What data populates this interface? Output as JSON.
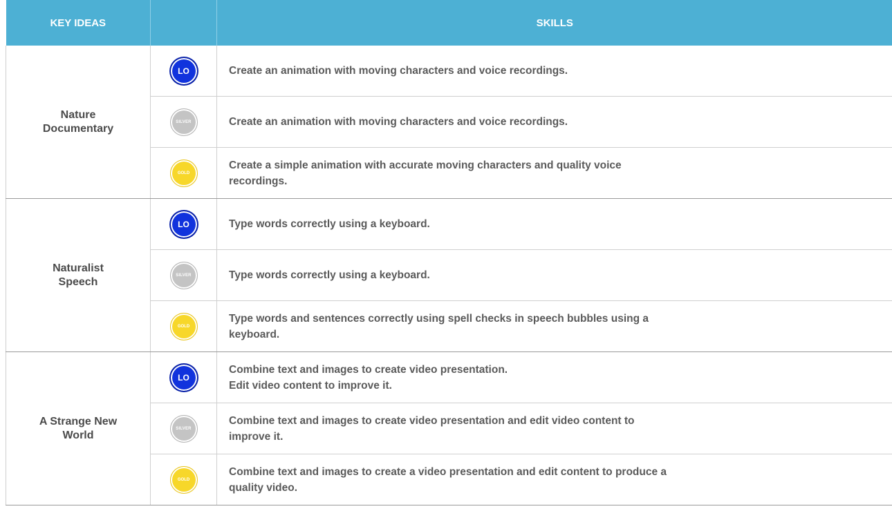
{
  "header": {
    "key_ideas": "KEY IDEAS",
    "skills": "SKILLS"
  },
  "badges": {
    "lo": "LO",
    "silver": "SILVER",
    "gold": "GOLD"
  },
  "colors": {
    "header_bg": "#4db0d4",
    "lo": "#1133dd",
    "silver": "#c4c4c4",
    "gold": "#f7d72a"
  },
  "groups": [
    {
      "key_idea_lines": [
        "Nature",
        "Documentary"
      ],
      "rows": [
        {
          "level": "lo",
          "text_lines": [
            "Create an animation with moving characters and voice recordings."
          ]
        },
        {
          "level": "silver",
          "text_lines": [
            "Create an animation with moving characters and voice recordings."
          ]
        },
        {
          "level": "gold",
          "text_lines": [
            "Create a simple animation with accurate moving characters and quality voice",
            "recordings."
          ]
        }
      ]
    },
    {
      "key_idea_lines": [
        "Naturalist",
        "Speech"
      ],
      "rows": [
        {
          "level": "lo",
          "text_lines": [
            "Type words correctly using a keyboard."
          ]
        },
        {
          "level": "silver",
          "text_lines": [
            "Type words correctly using a keyboard."
          ]
        },
        {
          "level": "gold",
          "text_lines": [
            "Type words and sentences correctly using spell checks in speech bubbles using a",
            "keyboard."
          ]
        }
      ]
    },
    {
      "key_idea_lines": [
        "A Strange New",
        "World"
      ],
      "rows": [
        {
          "level": "lo",
          "text_lines": [
            "Combine text and images to create video presentation.",
            "Edit video content to improve it."
          ]
        },
        {
          "level": "silver",
          "text_lines": [
            "Combine text and images to create video presentation and edit video content to",
            "improve it."
          ]
        },
        {
          "level": "gold",
          "text_lines": [
            "Combine text and images to create a video presentation and edit content to produce a",
            "quality video."
          ]
        }
      ]
    }
  ]
}
